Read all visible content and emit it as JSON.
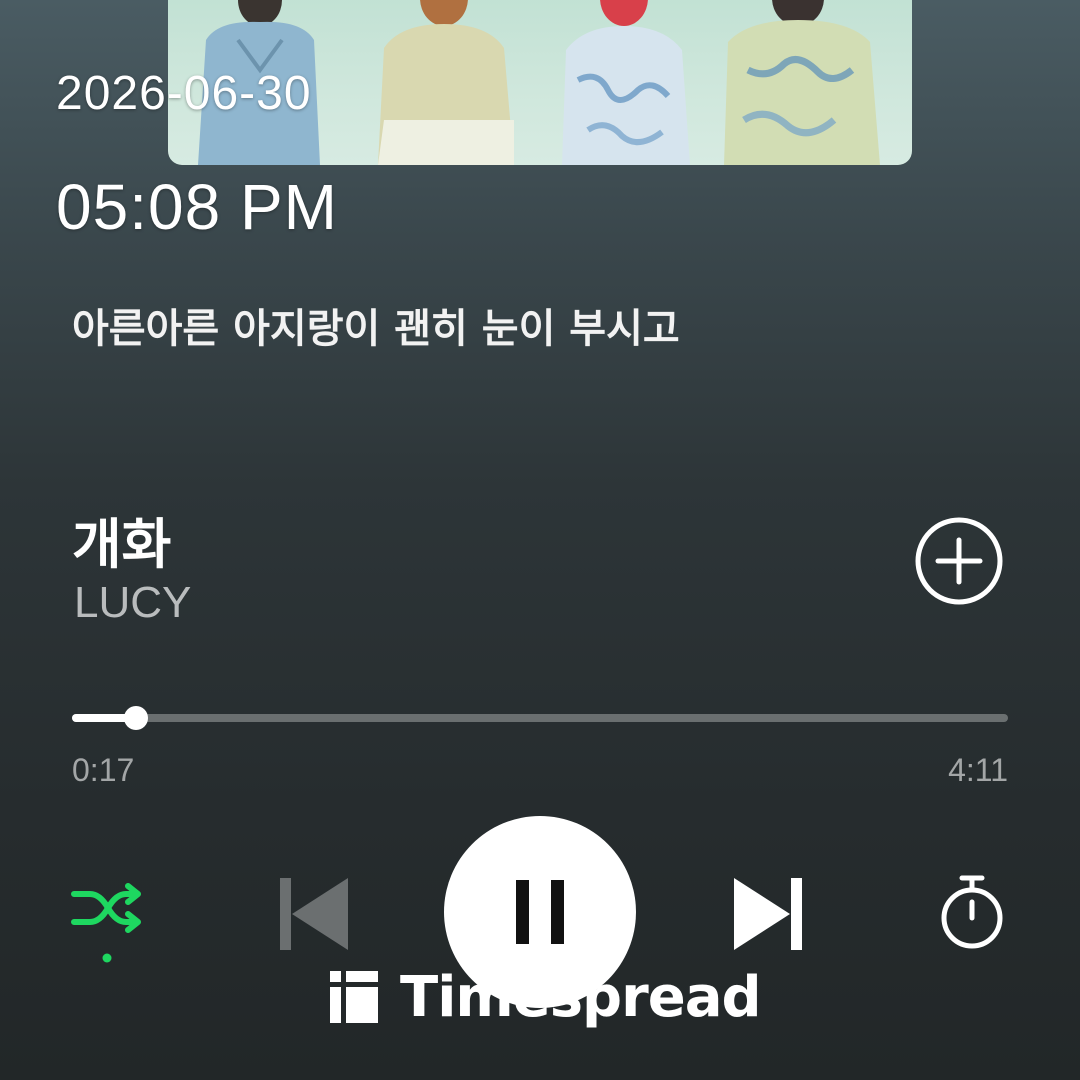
{
  "status": {
    "date": "2026-06-30",
    "time": "05:08 PM"
  },
  "lyrics": {
    "current_line": "아른아른 아지랑이 괜히 눈이 부시고"
  },
  "track": {
    "title": "개화",
    "artist": "LUCY"
  },
  "playback": {
    "elapsed": "0:17",
    "duration": "4:11",
    "progress_fraction": 0.068,
    "is_playing": true,
    "shuffle_on": true
  },
  "controls": {
    "shuffle_icon": "shuffle-icon",
    "previous_icon": "skip-previous-icon",
    "pause_icon": "pause-icon",
    "next_icon": "skip-next-icon",
    "timer_icon": "timer-icon",
    "add_icon": "add-circle-icon"
  },
  "colors": {
    "accent": "#1ed760",
    "background_top": "#4a5c63",
    "background_bottom": "#222728",
    "progress_remaining": "#6a6f70"
  },
  "watermark": {
    "text": "Timespread"
  }
}
